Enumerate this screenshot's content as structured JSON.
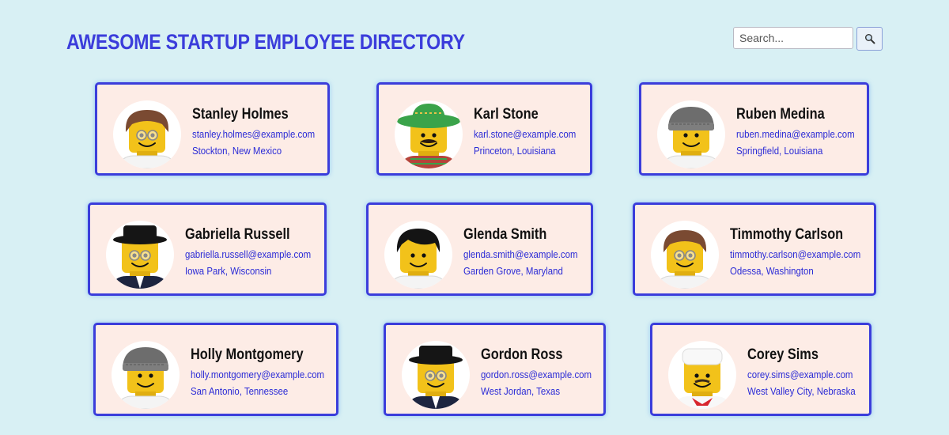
{
  "page": {
    "title": "AWESOME STARTUP EMPLOYEE DIRECTORY",
    "title_color": "#3b3ddb",
    "background": "#d8f0f4"
  },
  "search": {
    "placeholder": "Search...",
    "button_icon": "magnifier-icon"
  },
  "colors": {
    "card_background": "#fdece6",
    "card_border": "#3b3ddb",
    "link_text": "#2b2bd6"
  },
  "employees": [
    {
      "name": "Stanley Holmes",
      "email": "stanley.holmes@example.com",
      "location": "Stockton, New Mexico",
      "avatar": "brown-hair-glasses"
    },
    {
      "name": "Karl Stone",
      "email": "karl.stone@example.com",
      "location": "Princeton, Louisiana",
      "avatar": "sombrero-mustache"
    },
    {
      "name": "Ruben Medina",
      "email": "ruben.medina@example.com",
      "location": "Springfield, Louisiana",
      "avatar": "gray-beanie"
    },
    {
      "name": "Gabriella Russell",
      "email": "gabriella.russell@example.com",
      "location": "Iowa Park, Wisconsin",
      "avatar": "black-hat-glasses"
    },
    {
      "name": "Glenda Smith",
      "email": "glenda.smith@example.com",
      "location": "Garden Grove, Maryland",
      "avatar": "black-hair"
    },
    {
      "name": "Timmothy Carlson",
      "email": "timmothy.carlson@example.com",
      "location": "Odessa, Washington",
      "avatar": "brown-hair-glasses"
    },
    {
      "name": "Holly Montgomery",
      "email": "holly.montgomery@example.com",
      "location": "San Antonio, Tennessee",
      "avatar": "gray-beanie"
    },
    {
      "name": "Gordon Ross",
      "email": "gordon.ross@example.com",
      "location": "West Jordan, Texas",
      "avatar": "black-hat-glasses"
    },
    {
      "name": "Corey Sims",
      "email": "corey.sims@example.com",
      "location": "West Valley City, Nebraska",
      "avatar": "chef-hat-mustache"
    }
  ]
}
